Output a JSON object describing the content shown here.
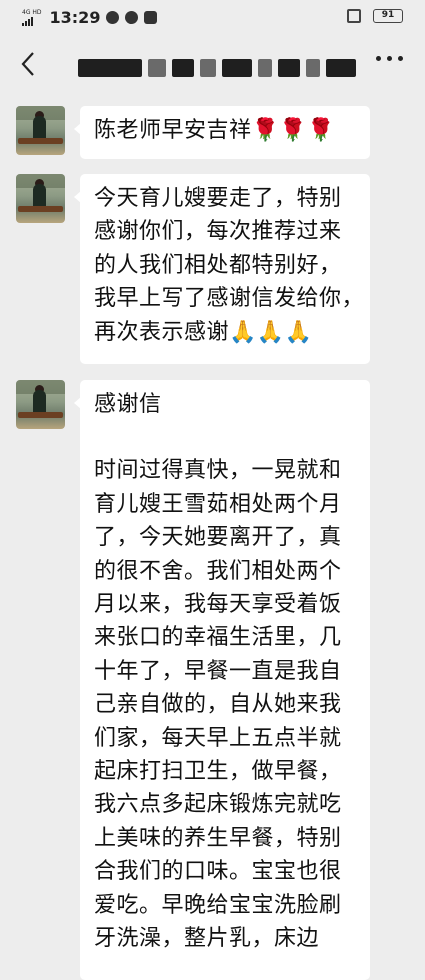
{
  "status_bar": {
    "network": "4G HD",
    "time": "13:29",
    "battery": "91"
  },
  "nav": {
    "back_icon": "chevron-left-icon",
    "title_redacted": true,
    "more_icon": "more-dots-icon"
  },
  "messages": [
    {
      "text_lines": [
        "陈老师早安吉祥🌹🌹🌹"
      ]
    },
    {
      "text_lines": [
        "今天育儿嫂要走了，特别",
        "感谢你们，每次推荐过来",
        "的人我们相处都特别好，",
        "我早上写了感谢信发给你，",
        "再次表示感谢🙏🙏🙏"
      ]
    },
    {
      "text_lines": [
        "感谢信",
        "",
        "时间过得真快，一晃就和",
        "育儿嫂王雪茹相处两个月",
        "了，今天她要离开了，真",
        "的很不舍。我们相处两个",
        "月以来，我每天享受着饭",
        "来张口的幸福生活里，几",
        "十年了，早餐一直是我自",
        "己亲自做的，自从她来我",
        "们家，每天早上五点半就",
        "起床打扫卫生，做早餐，",
        "我六点多起床锻炼完就吃",
        "上美味的养生早餐，特别",
        "合我们的口味。宝宝也很",
        "爱吃。早晚给宝宝洗脸刷",
        "牙洗澡，整片乳，床边"
      ]
    }
  ],
  "colors": {
    "background": "#ededed",
    "bubble": "#ffffff",
    "text": "#111111"
  }
}
